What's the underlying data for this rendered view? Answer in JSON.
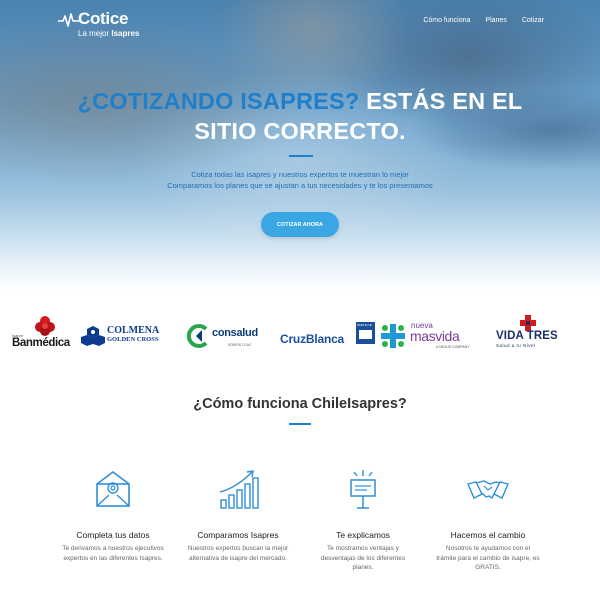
{
  "header": {
    "logo_title": "Cotice",
    "logo_sub_prefix": "La mejor",
    "logo_sub_bold": "Isapres",
    "nav": [
      "Cómo funciona",
      "Planes",
      "Cotizar"
    ]
  },
  "hero": {
    "title_highlight": "¿COTIZANDO ISAPRES?",
    "title_rest_1": " ESTÁS EN EL",
    "title_rest_2": "SITIO CORRECTO.",
    "line1": "Cotiza todas las isapres y nuestros expertos te muestran lo mejor",
    "line2": "Comparamos los planes que se ajustan a tus necesidades y te los presentamos",
    "cta": "Cotizar ahora"
  },
  "brands": {
    "banmedica_pre": "Isapre",
    "banmedica": "Banmédica",
    "colmena_1": "COLMENA",
    "colmena_2": "GOLDEN CROSS",
    "consalud": "consalud",
    "consalud_tag": "SOMOS CChC",
    "cruzblanca": "CruzBlanca",
    "cruzblanca_badge": "PARTE DE",
    "nueva_1": "nueva",
    "nueva_2": "masvida",
    "nueva_tag": "A NEXUS COMPANY",
    "vidatres": "VIDA TRES",
    "vidatres_tag": "Salud a tu Nivel"
  },
  "how": {
    "title": "¿Cómo funciona ChileIsapres?",
    "steps": [
      {
        "icon": "mail-icon",
        "title": "Completa tus datos",
        "desc": "Te derivamos a nuestros ejecutivos expertos en las diferentes Isapres."
      },
      {
        "icon": "growth-chart-icon",
        "title": "Comparamos Isapres",
        "desc": "Nuestros expertos buscan la mejor alternativa de isapre del mercado."
      },
      {
        "icon": "presentation-icon",
        "title": "Te explicamos",
        "desc": "Te mostramos ventajas y desventajas de los diferentes planes."
      },
      {
        "icon": "handshake-icon",
        "title": "Hacemos el cambio",
        "desc": "Nosotros te ayudamos con el trámite para el cambio de isapre, es GRATIS."
      }
    ]
  },
  "colors": {
    "accent": "#1f7fcb",
    "button": "#3aa7e4",
    "icon_blue": "#2f8fd8"
  }
}
